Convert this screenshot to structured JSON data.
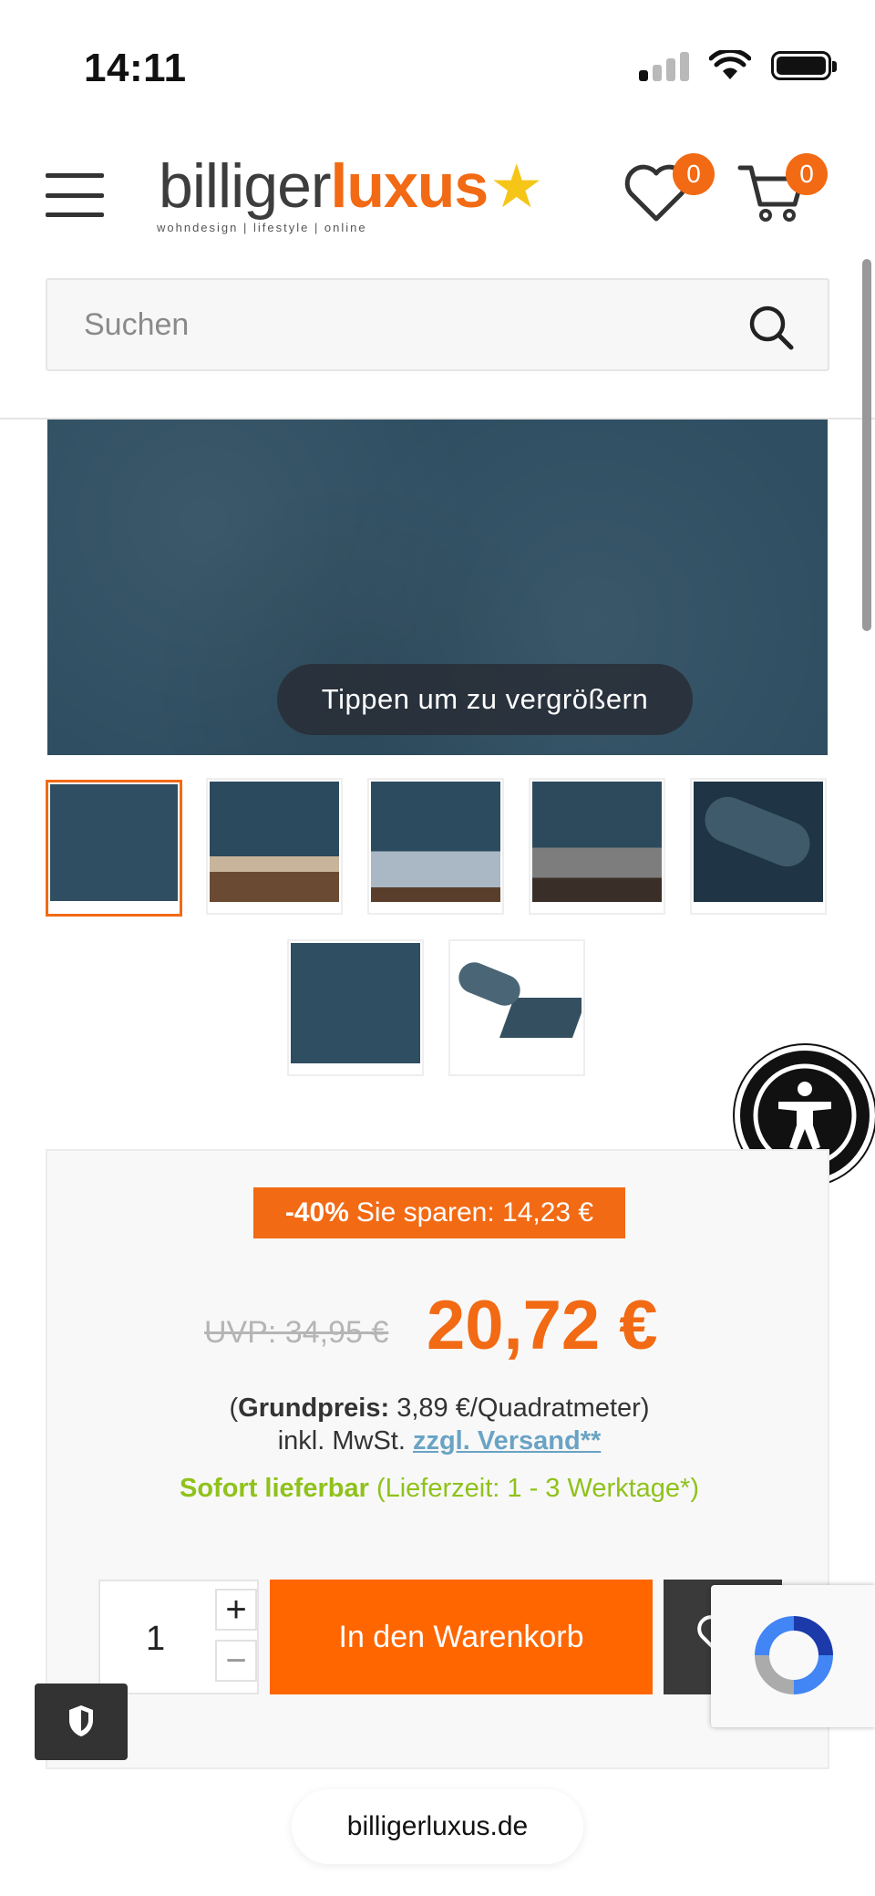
{
  "status_bar": {
    "time": "14:11"
  },
  "header": {
    "logo_part1": "billiger",
    "logo_part2": "luxus",
    "logo_tagline": "wohndesign | lifestyle | online",
    "wishlist_count": "0",
    "cart_count": "0"
  },
  "search": {
    "placeholder": "Suchen"
  },
  "gallery": {
    "zoom_hint": "Tippen um zu vergrößern",
    "thumbnail_count": 7,
    "active_index": 0
  },
  "price": {
    "discount_percent": "-40%",
    "savings_text": "Sie sparen: 14,23 €",
    "old_price": "UVP: 34,95 €",
    "new_price": "20,72 €",
    "grundpreis_label": "Grundpreis:",
    "grundpreis_value": "3,89 €/Quadratmeter",
    "tax_text": "inkl. MwSt.",
    "shipping_link": "zzgl. Versand**",
    "availability": "Sofort lieferbar",
    "delivery_time": "(Lieferzeit: 1 - 3 Werktage*)"
  },
  "cart_form": {
    "quantity": "1",
    "plus": "+",
    "minus": "−",
    "add_to_cart_label": "In den Warenkorb"
  },
  "browser": {
    "url": "billigerluxus.de"
  },
  "colors": {
    "accent": "#f26a14",
    "button": "#ff6600",
    "stock_green": "#8fc21b",
    "wallpaper": "#2f4e61"
  }
}
